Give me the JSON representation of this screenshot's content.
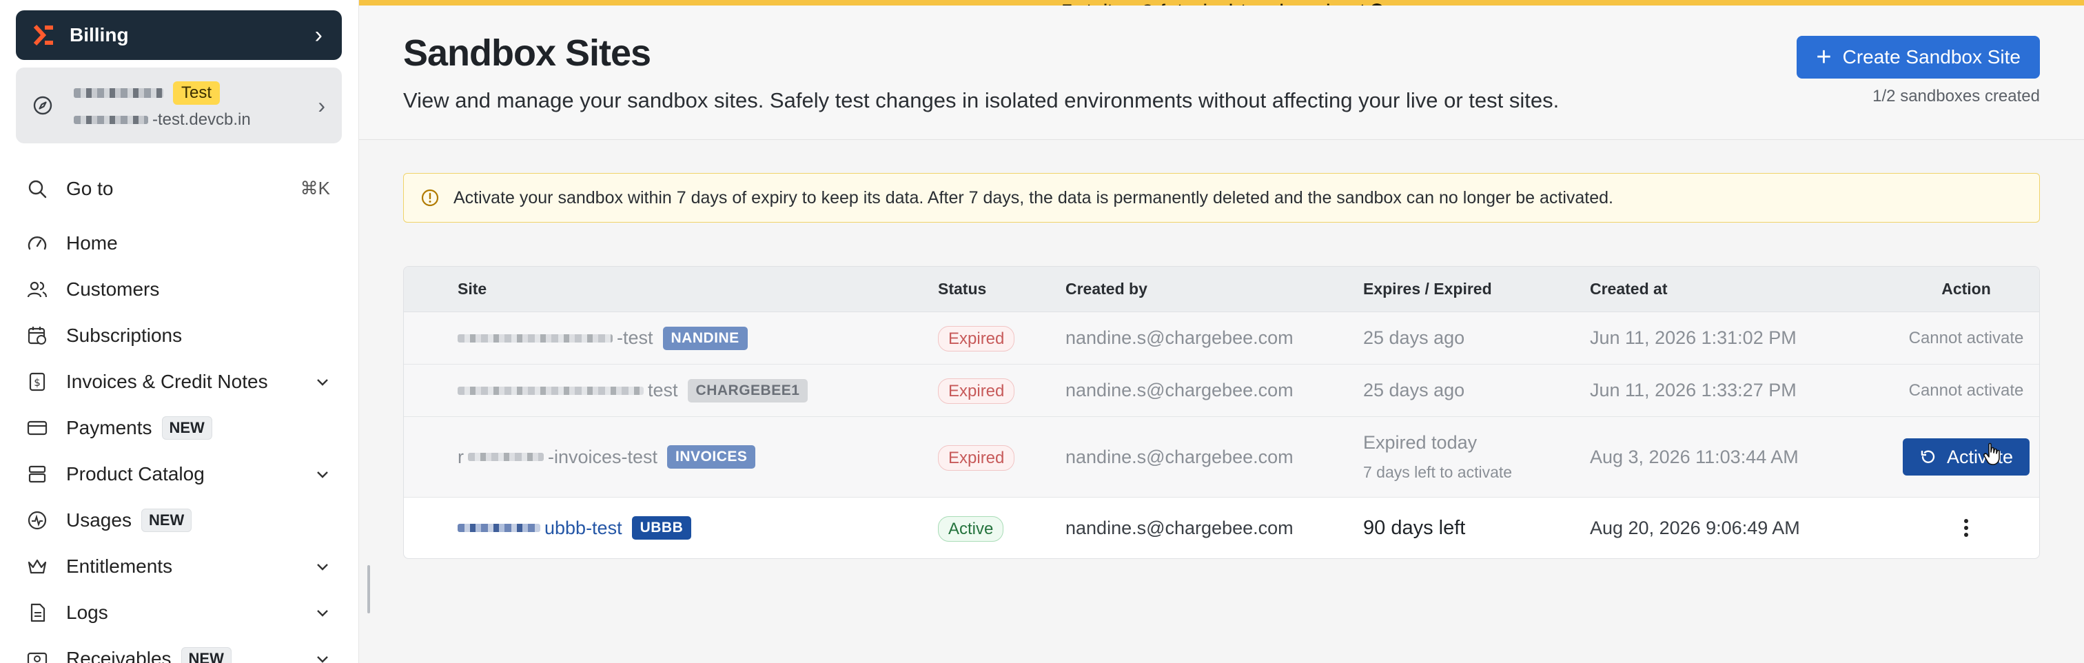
{
  "sidebar": {
    "billing_label": "Billing",
    "site_badge": "Test",
    "site_domain_suffix": "-test.devcb.in",
    "goto_label": "Go to",
    "goto_shortcut": "⌘K",
    "nav": [
      {
        "label": "Home",
        "icon": "gauge-icon"
      },
      {
        "label": "Customers",
        "icon": "users-icon"
      },
      {
        "label": "Subscriptions",
        "icon": "calendar-refresh-icon"
      },
      {
        "label": "Invoices & Credit Notes",
        "icon": "dollar-doc-icon",
        "expandable": true
      },
      {
        "label": "Payments",
        "icon": "card-icon",
        "badge": "NEW"
      },
      {
        "label": "Product Catalog",
        "icon": "box-icon",
        "expandable": true
      },
      {
        "label": "Usages",
        "icon": "activity-icon",
        "badge": "NEW"
      },
      {
        "label": "Entitlements",
        "icon": "crown-icon",
        "expandable": true
      },
      {
        "label": "Logs",
        "icon": "file-icon",
        "expandable": true
      },
      {
        "label": "Receivables",
        "icon": "money-icon",
        "badge": "NEW",
        "expandable": true
      }
    ]
  },
  "banner": {
    "test_site_text": "Test site — Safe to simulate and experiment"
  },
  "header": {
    "title": "Sandbox Sites",
    "description": "View and manage your sandbox sites. Safely test changes in isolated environments without affecting your live or test sites.",
    "create_label": "Create Sandbox Site",
    "count_text": "1/2 sandboxes created"
  },
  "alert": {
    "text": "Activate your sandbox within 7 days of expiry to keep its data. After 7 days, the data is permanently deleted and the sandbox can no longer be activated."
  },
  "table": {
    "columns": {
      "site": "Site",
      "status": "Status",
      "created_by": "Created by",
      "expires": "Expires / Expired",
      "created_at": "Created at",
      "action": "Action"
    },
    "rows": [
      {
        "site_suffix": "-test",
        "tag": "NANDINE",
        "status": "Expired",
        "created_by": "nandine.s@chargebee.com",
        "expires": "25 days ago",
        "created_at": "Jun 11, 2026 1:31:02 PM",
        "action": "Cannot activate"
      },
      {
        "site_suffix": "test",
        "tag": "CHARGEBEE1",
        "status": "Expired",
        "created_by": "nandine.s@chargebee.com",
        "expires": "25 days ago",
        "created_at": "Jun 11, 2026 1:33:27 PM",
        "action": "Cannot activate"
      },
      {
        "site_prefix": "r",
        "site_suffix": "-invoices-test",
        "tag": "INVOICES",
        "status": "Expired",
        "created_by": "nandine.s@chargebee.com",
        "expires": "Expired today",
        "expires_note": "7 days left to activate",
        "created_at": "Aug 3, 2026 11:03:44 AM",
        "action": "Activate"
      },
      {
        "site_suffix": "ubbb-test",
        "tag": "UBBB",
        "status": "Active",
        "created_by": "nandine.s@chargebee.com",
        "expires": "90 days left",
        "created_at": "Aug 20, 2026 9:06:49 AM"
      }
    ]
  }
}
